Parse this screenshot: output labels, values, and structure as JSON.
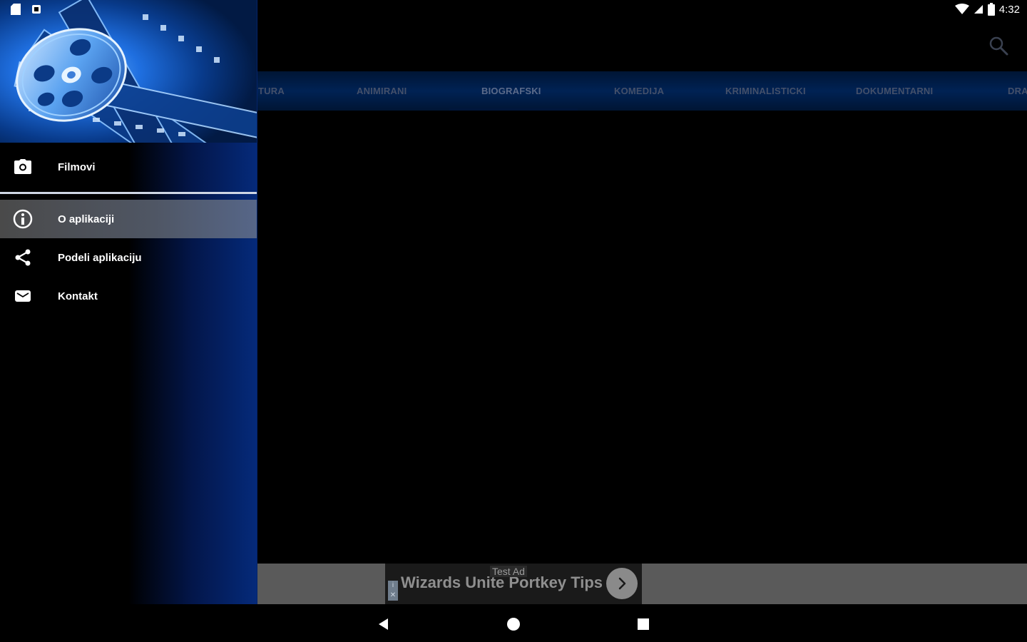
{
  "status_bar": {
    "time": "4:32"
  },
  "tabs": [
    {
      "label": "TURA",
      "active": false
    },
    {
      "label": "ANIMIRANI",
      "active": false
    },
    {
      "label": "BIOGRAFSKI",
      "active": true
    },
    {
      "label": "KOMEDIJA",
      "active": false
    },
    {
      "label": "KRIMINALISTICKI",
      "active": false
    },
    {
      "label": "DOKUMENTARNI",
      "active": false
    },
    {
      "label": "DRA",
      "active": false
    }
  ],
  "drawer": {
    "items": [
      {
        "label": "Filmovi",
        "icon": "camera-icon"
      },
      {
        "label": "O aplikaciji",
        "icon": "info-icon",
        "selected": true
      },
      {
        "label": "Podeli aplikaciju",
        "icon": "share-icon"
      },
      {
        "label": "Kontakt",
        "icon": "email-icon"
      }
    ]
  },
  "ad": {
    "test_label": "Test Ad",
    "title": "Wizards Unite Portkey Tips",
    "choice_mark": "i"
  },
  "colors": {
    "drawer_accent": "#052a7a",
    "tab_bar": "#002254",
    "ad_strip": "#5a5a5a"
  }
}
